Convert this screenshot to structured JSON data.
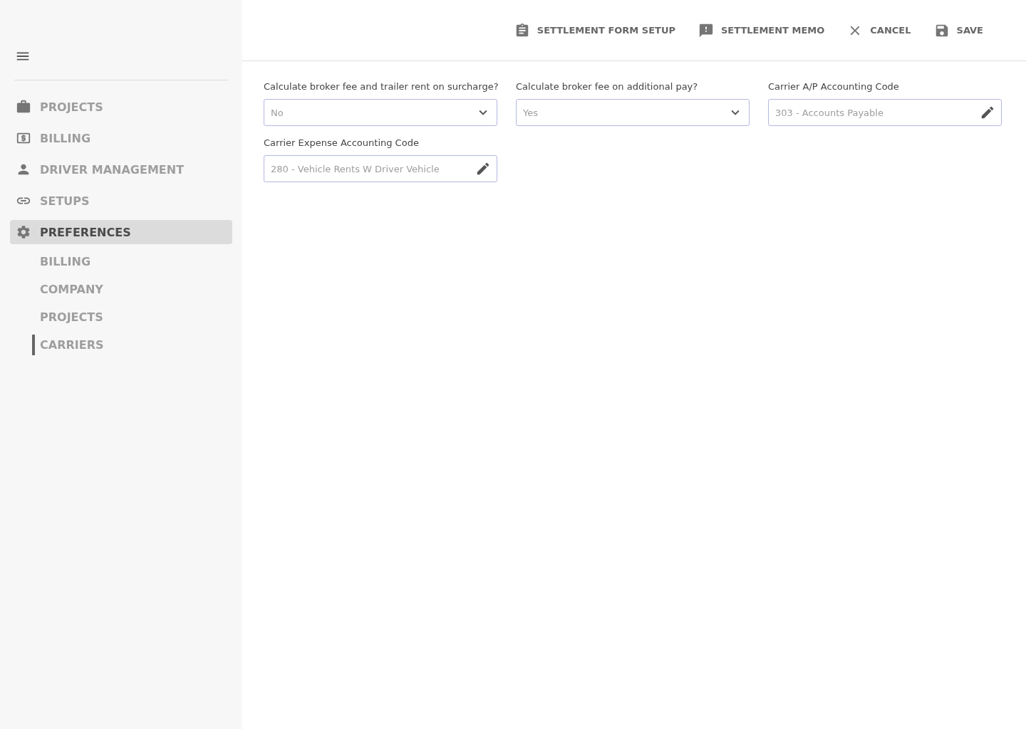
{
  "sidebar": {
    "items": [
      {
        "label": "PROJECTS",
        "kind": "briefcase",
        "selected": false
      },
      {
        "label": "BILLING",
        "kind": "money",
        "selected": false
      },
      {
        "label": "DRIVER MANAGEMENT",
        "kind": "person",
        "selected": false
      },
      {
        "label": "SETUPS",
        "kind": "link",
        "selected": false
      },
      {
        "label": "PREFERENCES",
        "kind": "gear",
        "selected": true,
        "children": [
          {
            "label": "BILLING",
            "selected": false
          },
          {
            "label": "COMPANY",
            "selected": false
          },
          {
            "label": "PROJECTS",
            "selected": false
          },
          {
            "label": "CARRIERS",
            "selected": true
          }
        ]
      }
    ]
  },
  "toolbar": [
    {
      "label": "SETTLEMENT FORM SETUP",
      "kind": "clipboard"
    },
    {
      "label": "SETTLEMENT MEMO",
      "kind": "memo"
    },
    {
      "label": "CANCEL",
      "kind": "close"
    },
    {
      "label": "SAVE",
      "kind": "save"
    }
  ],
  "fields": [
    {
      "label": "Calculate broker fee and trailer rent on surcharge?",
      "value": "No",
      "kind": "select"
    },
    {
      "label": "Calculate broker fee on additional pay?",
      "value": "Yes",
      "kind": "select"
    },
    {
      "label": "Carrier A/P Accounting Code",
      "value": "303 - Accounts Payable",
      "kind": "edit"
    },
    {
      "label": "Carrier Expense Accounting Code",
      "value": "280 - Vehicle Rents W Driver Vehicle",
      "kind": "edit"
    }
  ]
}
